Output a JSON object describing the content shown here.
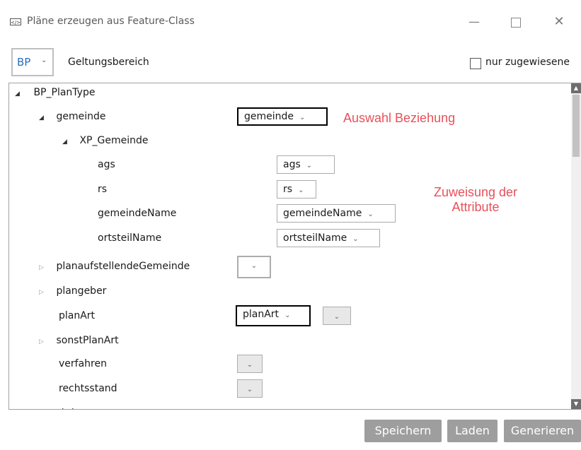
{
  "window": {
    "title": "Pläne erzeugen aus Feature-Class",
    "icon": "xml-icon",
    "min_glyph": "—",
    "close_glyph": "✕"
  },
  "toolbar": {
    "scope_value": "BP",
    "scope_label": "Geltungsbereich",
    "assigned_only_label": "nur zugewiesene",
    "assigned_only_checked": false
  },
  "tree": {
    "root": "BP_PlanType",
    "gemeinde": "gemeinde",
    "gemeinde_value": "gemeinde",
    "xp_gemeinde": "XP_Gemeinde",
    "ags": "ags",
    "ags_value": "ags",
    "rs": "rs",
    "rs_value": "rs",
    "gemeindeName": "gemeindeName",
    "gemeindeName_value": "gemeindeName",
    "ortsteilName": "ortsteilName",
    "ortsteilName_value": "ortsteilName",
    "planaufstellendeGemeinde": "planaufstellendeGemeinde",
    "plangeber": "plangeber",
    "planArt": "planArt",
    "planArt_value": "planArt",
    "sonstPlanArt": "sonstPlanArt",
    "verfahren": "verfahren",
    "rechtsstand": "rechtsstand",
    "status": "status"
  },
  "glyphs": {
    "expanded": "◢",
    "collapsed": "▷",
    "dropdown": "⌄"
  },
  "annotations": {
    "relation": "Auswahl Beziehung",
    "attributes_line1": "Zuweisung der",
    "attributes_line2": "Attribute"
  },
  "buttons": {
    "save": "Speichern",
    "load": "Laden",
    "generate": "Generieren"
  },
  "colors": {
    "annotation": "#e8505b",
    "button_bg": "#9e9e9e",
    "scope_text": "#2d6dbd"
  }
}
